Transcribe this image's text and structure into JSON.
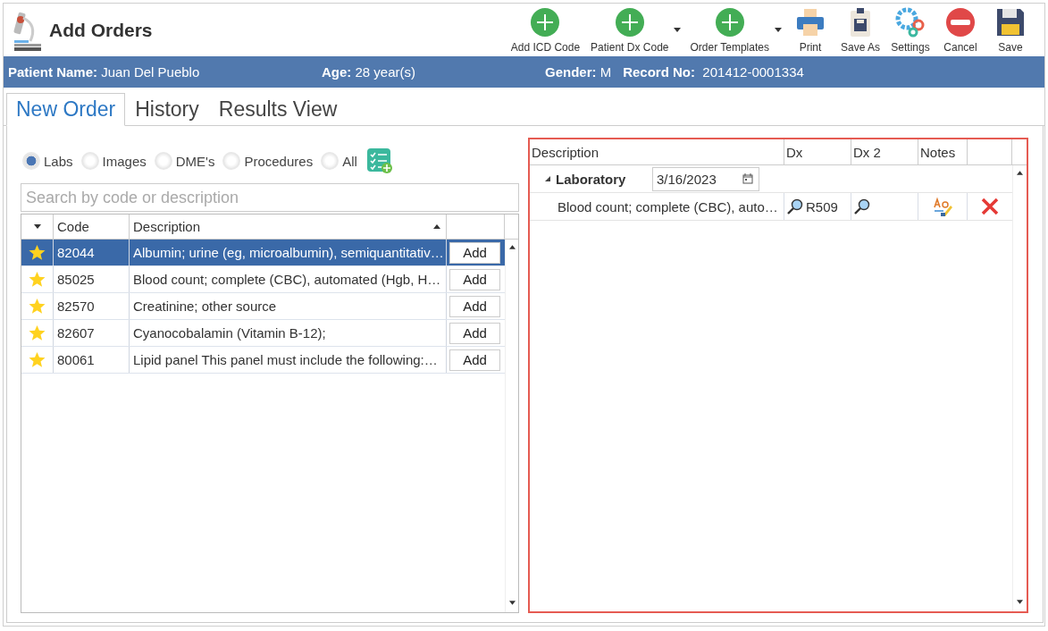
{
  "window": {
    "title": "Add Orders"
  },
  "toolbar": [
    {
      "label": "Add ICD Code",
      "kind": "add",
      "dropdown": false
    },
    {
      "label": "Patient Dx Code",
      "kind": "add",
      "dropdown": true
    },
    {
      "label": "Order Templates",
      "kind": "add",
      "dropdown": true
    },
    {
      "label": "Print",
      "kind": "print",
      "dropdown": false
    },
    {
      "label": "Save As",
      "kind": "saveas",
      "dropdown": false
    },
    {
      "label": "Settings",
      "kind": "settings",
      "dropdown": false
    },
    {
      "label": "Cancel",
      "kind": "cancel",
      "dropdown": false
    },
    {
      "label": "Save",
      "kind": "save",
      "dropdown": false
    }
  ],
  "patient": {
    "name_label": "Patient Name:",
    "name": "Juan Del Pueblo",
    "age_label": "Age:",
    "age": "28 year(s)",
    "gender_label": "Gender:",
    "gender": "M",
    "record_label": "Record No:",
    "record": "201412-0001334"
  },
  "tabs": [
    {
      "label": "New Order",
      "selected": true
    },
    {
      "label": "History",
      "selected": false
    },
    {
      "label": "Results View",
      "selected": false
    }
  ],
  "filters": [
    {
      "label": "Labs",
      "selected": true
    },
    {
      "label": "Images",
      "selected": false
    },
    {
      "label": "DME's",
      "selected": false
    },
    {
      "label": "Procedures",
      "selected": false
    },
    {
      "label": "All",
      "selected": false
    }
  ],
  "search": {
    "placeholder": "Search by code or description"
  },
  "codes_table": {
    "columns": [
      "Code",
      "Description"
    ],
    "rows": [
      {
        "favorite": true,
        "code": "82044",
        "description": "Albumin; urine (eg, microalbumin), semiquantitativ…",
        "action": "Add",
        "selected": true
      },
      {
        "favorite": true,
        "code": "85025",
        "description": "Blood count; complete (CBC), automated (Hgb, H…",
        "action": "Add",
        "selected": false
      },
      {
        "favorite": true,
        "code": "82570",
        "description": "Creatinine; other source",
        "action": "Add",
        "selected": false
      },
      {
        "favorite": true,
        "code": "82607",
        "description": "Cyanocobalamin (Vitamin B-12);",
        "action": "Add",
        "selected": false
      },
      {
        "favorite": true,
        "code": "80061",
        "description": "Lipid panel This panel must include the following:…",
        "action": "Add",
        "selected": false
      }
    ]
  },
  "order_table": {
    "columns": [
      "Description",
      "Dx",
      "Dx 2",
      "Notes"
    ],
    "groups": [
      {
        "name": "Laboratory",
        "expanded": true,
        "date": "3/16/2023",
        "items": [
          {
            "description": "Blood count; complete (CBC), auto…",
            "dx": "R509"
          }
        ]
      }
    ]
  }
}
